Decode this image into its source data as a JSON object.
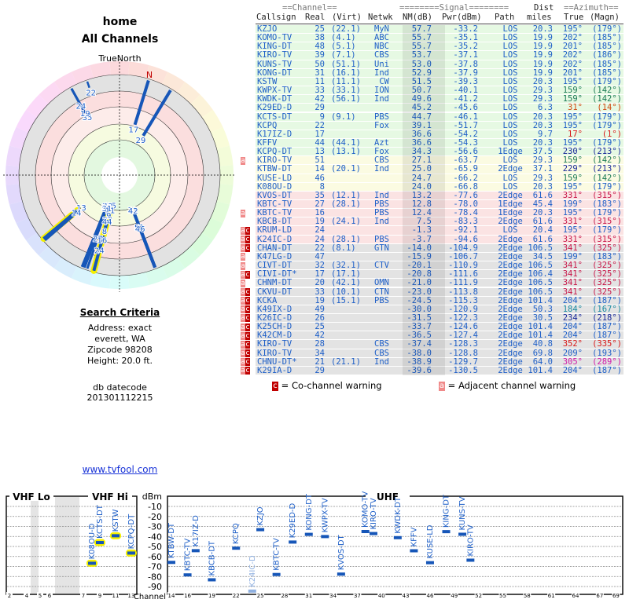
{
  "left": {
    "title": "home",
    "subtitle": "All Channels",
    "compass_label": "TrueNorth",
    "north_marker": "N",
    "search_heading": "Search Criteria",
    "search_lines": [
      "Address: exact",
      "everett, WA",
      "Zipcode 98208",
      "Height: 20.0 ft."
    ],
    "datecode_label": "db datecode",
    "datecode": "201301112215",
    "link": "www.tvfool.com"
  },
  "table": {
    "header_top": {
      "channel": "==Channel==",
      "signal": "========Signal========",
      "dist": "Dist",
      "azimuth": "==Azimuth=="
    },
    "header": {
      "callsign": "Callsign",
      "real": "Real",
      "virt": "(Virt)",
      "netwk": "Netwk",
      "nm": "NM(dB)",
      "pwr": "Pwr(dBm)",
      "path": "Path",
      "miles": "miles",
      "true": "True",
      "magn": "(Magn)"
    },
    "rows": [
      {
        "w": "",
        "call": "KZJO",
        "real": "25",
        "virt": "(22.1)",
        "net": "MyN",
        "nm": "57.7",
        "pwr": "-33.2",
        "path": "LOS",
        "dist": "20.3",
        "az": "195°",
        "mag": "(179°)",
        "color": "#1e5fc8",
        "band": "green"
      },
      {
        "w": "",
        "call": "KOMO-TV",
        "real": "38",
        "virt": "(4.1)",
        "net": "ABC",
        "nm": "55.7",
        "pwr": "-35.1",
        "path": "LOS",
        "dist": "19.9",
        "az": "202°",
        "mag": "(185°)",
        "color": "#1e5fc8",
        "band": "green"
      },
      {
        "w": "",
        "call": "KING-DT",
        "real": "48",
        "virt": "(5.1)",
        "net": "NBC",
        "nm": "55.7",
        "pwr": "-35.2",
        "path": "LOS",
        "dist": "19.9",
        "az": "201°",
        "mag": "(185°)",
        "color": "#1e5fc8",
        "band": "green"
      },
      {
        "w": "",
        "call": "KIRO-TV",
        "real": "39",
        "virt": "(7.1)",
        "net": "CBS",
        "nm": "53.7",
        "pwr": "-37.1",
        "path": "LOS",
        "dist": "19.9",
        "az": "202°",
        "mag": "(186°)",
        "color": "#1e5fc8",
        "band": "green"
      },
      {
        "w": "",
        "call": "KUNS-TV",
        "real": "50",
        "virt": "(51.1)",
        "net": "Uni",
        "nm": "53.0",
        "pwr": "-37.8",
        "path": "LOS",
        "dist": "19.9",
        "az": "202°",
        "mag": "(185°)",
        "color": "#1e5fc8",
        "band": "green"
      },
      {
        "w": "",
        "call": "KONG-DT",
        "real": "31",
        "virt": "(16.1)",
        "net": "Ind",
        "nm": "52.9",
        "pwr": "-37.9",
        "path": "LOS",
        "dist": "19.9",
        "az": "201°",
        "mag": "(185°)",
        "color": "#1e5fc8",
        "band": "green"
      },
      {
        "w": "",
        "call": "KSTW",
        "real": "11",
        "virt": "(11.1)",
        "net": "CW",
        "nm": "51.5",
        "pwr": "-39.3",
        "path": "LOS",
        "dist": "20.3",
        "az": "195°",
        "mag": "(179°)",
        "color": "#1e5fc8",
        "band": "green"
      },
      {
        "w": "",
        "call": "KWPX-TV",
        "real": "33",
        "virt": "(33.1)",
        "net": "ION",
        "nm": "50.7",
        "pwr": "-40.1",
        "path": "LOS",
        "dist": "29.3",
        "az": "159°",
        "mag": "(142°)",
        "color": "#1a7a55",
        "band": "green"
      },
      {
        "w": "",
        "call": "KWDK-DT",
        "real": "42",
        "virt": "(56.1)",
        "net": "Ind",
        "nm": "49.6",
        "pwr": "-41.2",
        "path": "LOS",
        "dist": "29.3",
        "az": "159°",
        "mag": "(142°)",
        "color": "#1a7a55",
        "band": "green"
      },
      {
        "w": "",
        "call": "K29ED-D",
        "real": "29",
        "virt": "",
        "net": "",
        "nm": "45.2",
        "pwr": "-45.6",
        "path": "LOS",
        "dist": "6.3",
        "az": "31°",
        "mag": "(14°)",
        "color": "#d04a10",
        "band": "green"
      },
      {
        "w": "",
        "call": "KCTS-DT",
        "real": "9",
        "virt": "(9.1)",
        "net": "PBS",
        "nm": "44.7",
        "pwr": "-46.1",
        "path": "LOS",
        "dist": "20.3",
        "az": "195°",
        "mag": "(179°)",
        "color": "#1e5fc8",
        "band": "green"
      },
      {
        "w": "",
        "call": "KCPQ",
        "real": "22",
        "virt": "",
        "net": "Fox",
        "nm": "39.1",
        "pwr": "-51.7",
        "path": "LOS",
        "dist": "20.3",
        "az": "195°",
        "mag": "(179°)",
        "color": "#1e5fc8",
        "band": "green"
      },
      {
        "w": "",
        "call": "K17IZ-D",
        "real": "17",
        "virt": "",
        "net": "",
        "nm": "36.6",
        "pwr": "-54.2",
        "path": "LOS",
        "dist": "9.7",
        "az": "17°",
        "mag": "(1°)",
        "color": "#d81818",
        "band": "green"
      },
      {
        "w": "",
        "call": "KFFV",
        "real": "44",
        "virt": "(44.1)",
        "net": "Azt",
        "nm": "36.6",
        "pwr": "-54.3",
        "path": "LOS",
        "dist": "20.3",
        "az": "195°",
        "mag": "(179°)",
        "color": "#1e5fc8",
        "band": "green"
      },
      {
        "w": "",
        "call": "KCPQ-DT",
        "real": "13",
        "virt": "(13.1)",
        "net": "Fox",
        "nm": "34.3",
        "pwr": "-56.6",
        "path": "1Edge",
        "dist": "37.5",
        "az": "230°",
        "mag": "(213°)",
        "color": "#1a2a9a",
        "band": "green"
      },
      {
        "w": "a",
        "call": "KIRO-TV",
        "real": "51",
        "virt": "",
        "net": "CBS",
        "nm": "27.1",
        "pwr": "-63.7",
        "path": "LOS",
        "dist": "29.3",
        "az": "159°",
        "mag": "(142°)",
        "color": "#1a7a55",
        "band": "yellow"
      },
      {
        "w": "",
        "call": "KTBW-DT",
        "real": "14",
        "virt": "(20.1)",
        "net": "Ind",
        "nm": "25.0",
        "pwr": "-65.9",
        "path": "2Edge",
        "dist": "37.1",
        "az": "229°",
        "mag": "(213°)",
        "color": "#1a2a9a",
        "band": "yellow"
      },
      {
        "w": "",
        "call": "KUSE-LD",
        "real": "46",
        "virt": "",
        "net": "",
        "nm": "24.7",
        "pwr": "-66.2",
        "path": "LOS",
        "dist": "29.3",
        "az": "159°",
        "mag": "(142°)",
        "color": "#1a7a55",
        "band": "yellow"
      },
      {
        "w": "",
        "call": "K08OU-D",
        "real": "8",
        "virt": "",
        "net": "",
        "nm": "24.0",
        "pwr": "-66.8",
        "path": "LOS",
        "dist": "20.3",
        "az": "195°",
        "mag": "(179°)",
        "color": "#1e5fc8",
        "band": "yellow"
      },
      {
        "w": "",
        "call": "KVOS-DT",
        "real": "35",
        "virt": "(12.1)",
        "net": "Ind",
        "nm": "13.2",
        "pwr": "-77.6",
        "path": "2Edge",
        "dist": "61.6",
        "az": "331°",
        "mag": "(315°)",
        "color": "#c8184a",
        "band": "pink"
      },
      {
        "w": "",
        "call": "KBTC-TV",
        "real": "27",
        "virt": "(28.1)",
        "net": "PBS",
        "nm": "12.8",
        "pwr": "-78.0",
        "path": "1Edge",
        "dist": "45.4",
        "az": "199°",
        "mag": "(183°)",
        "color": "#1e5fc8",
        "band": "pink"
      },
      {
        "w": "a",
        "call": "KBTC-TV",
        "real": "16",
        "virt": "",
        "net": "PBS",
        "nm": "12.4",
        "pwr": "-78.4",
        "path": "1Edge",
        "dist": "20.3",
        "az": "195°",
        "mag": "(179°)",
        "color": "#1e5fc8",
        "band": "pink"
      },
      {
        "w": "",
        "call": "KBCB-DT",
        "real": "19",
        "virt": "(24.1)",
        "net": "Ind",
        "nm": "7.5",
        "pwr": "-83.3",
        "path": "2Edge",
        "dist": "61.6",
        "az": "331°",
        "mag": "(315°)",
        "color": "#c8184a",
        "band": "pink"
      },
      {
        "w": "ac",
        "call": "KRUM-LD",
        "real": "24",
        "virt": "",
        "net": "",
        "nm": "-1.3",
        "pwr": "-92.1",
        "path": "LOS",
        "dist": "20.4",
        "az": "195°",
        "mag": "(179°)",
        "color": "#1e5fc8",
        "band": "pink"
      },
      {
        "w": "ac",
        "call": "K24IC-D",
        "real": "24",
        "virt": "(28.1)",
        "net": "PBS",
        "nm": "-3.7",
        "pwr": "-94.6",
        "path": "2Edge",
        "dist": "61.6",
        "az": "331°",
        "mag": "(315°)",
        "color": "#c8184a",
        "band": "pink"
      },
      {
        "w": "ac",
        "call": "CHAN-DT",
        "real": "22",
        "virt": "(8.1)",
        "net": "GTN",
        "nm": "-14.0",
        "pwr": "-104.9",
        "path": "2Edge",
        "dist": "106.5",
        "az": "341°",
        "mag": "(325°)",
        "color": "#c8184a",
        "band": "gray"
      },
      {
        "w": "a",
        "call": "K47LG-D",
        "real": "47",
        "virt": "",
        "net": "",
        "nm": "-15.9",
        "pwr": "-106.7",
        "path": "2Edge",
        "dist": "34.5",
        "az": "199°",
        "mag": "(183°)",
        "color": "#1e5fc8",
        "band": "gray"
      },
      {
        "w": "a",
        "call": "CIVT-DT",
        "real": "32",
        "virt": "(32.1)",
        "net": "CTV",
        "nm": "-20.1",
        "pwr": "-110.9",
        "path": "2Edge",
        "dist": "106.5",
        "az": "341°",
        "mag": "(325°)",
        "color": "#c8184a",
        "band": "gray"
      },
      {
        "w": "ac",
        "call": "CIVI-DT*",
        "real": "17",
        "virt": "(17.1)",
        "net": "",
        "nm": "-20.8",
        "pwr": "-111.6",
        "path": "2Edge",
        "dist": "106.4",
        "az": "341°",
        "mag": "(325°)",
        "color": "#c8184a",
        "band": "gray"
      },
      {
        "w": "a",
        "call": "CHNM-DT",
        "real": "20",
        "virt": "(42.1)",
        "net": "OMN",
        "nm": "-21.0",
        "pwr": "-111.9",
        "path": "2Edge",
        "dist": "106.5",
        "az": "341°",
        "mag": "(325°)",
        "color": "#c8184a",
        "band": "gray"
      },
      {
        "w": "ac",
        "call": "CKVU-DT",
        "real": "33",
        "virt": "(10.1)",
        "net": "CTN",
        "nm": "-23.0",
        "pwr": "-113.8",
        "path": "2Edge",
        "dist": "106.5",
        "az": "341°",
        "mag": "(325°)",
        "color": "#c8184a",
        "band": "gray"
      },
      {
        "w": "ac",
        "call": "KCKA",
        "real": "19",
        "virt": "(15.1)",
        "net": "PBS",
        "nm": "-24.5",
        "pwr": "-115.3",
        "path": "2Edge",
        "dist": "101.4",
        "az": "204°",
        "mag": "(187°)",
        "color": "#1e5fc8",
        "band": "gray"
      },
      {
        "w": "ac",
        "call": "K49IX-D",
        "real": "49",
        "virt": "",
        "net": "",
        "nm": "-30.0",
        "pwr": "-120.9",
        "path": "2Edge",
        "dist": "50.3",
        "az": "184°",
        "mag": "(167°)",
        "color": "#1a8aa0",
        "band": "gray"
      },
      {
        "w": "ac",
        "call": "K26IC-D",
        "real": "26",
        "virt": "",
        "net": "",
        "nm": "-31.5",
        "pwr": "-122.3",
        "path": "2Edge",
        "dist": "30.5",
        "az": "234°",
        "mag": "(218°)",
        "color": "#1a2a9a",
        "band": "gray"
      },
      {
        "w": "ac",
        "call": "K25CH-D",
        "real": "25",
        "virt": "",
        "net": "",
        "nm": "-33.7",
        "pwr": "-124.6",
        "path": "2Edge",
        "dist": "101.4",
        "az": "204°",
        "mag": "(187°)",
        "color": "#1e5fc8",
        "band": "gray"
      },
      {
        "w": "ac",
        "call": "K42CM-D",
        "real": "42",
        "virt": "",
        "net": "",
        "nm": "-36.5",
        "pwr": "-127.4",
        "path": "2Edge",
        "dist": "101.4",
        "az": "204°",
        "mag": "(187°)",
        "color": "#1e5fc8",
        "band": "gray"
      },
      {
        "w": "ac",
        "call": "KIRO-TV",
        "real": "28",
        "virt": "",
        "net": "CBS",
        "nm": "-37.4",
        "pwr": "-128.3",
        "path": "2Edge",
        "dist": "40.8",
        "az": "352°",
        "mag": "(335°)",
        "color": "#d81818",
        "band": "gray"
      },
      {
        "w": "ac",
        "call": "KIRO-TV",
        "real": "34",
        "virt": "",
        "net": "CBS",
        "nm": "-38.0",
        "pwr": "-128.8",
        "path": "2Edge",
        "dist": "69.8",
        "az": "209°",
        "mag": "(193°)",
        "color": "#1e5fc8",
        "band": "gray"
      },
      {
        "w": "ac",
        "call": "CHNU-DT*",
        "real": "21",
        "virt": "(21.1)",
        "net": "Ind",
        "nm": "-38.9",
        "pwr": "-129.7",
        "path": "2Edge",
        "dist": "64.0",
        "az": "305°",
        "mag": "(289°)",
        "color": "#d018a8",
        "band": "gray"
      },
      {
        "w": "ac",
        "call": "K29IA-D",
        "real": "29",
        "virt": "",
        "net": "",
        "nm": "-39.6",
        "pwr": "-130.5",
        "path": "2Edge",
        "dist": "101.4",
        "az": "204°",
        "mag": "(187°)",
        "color": "#1e5fc8",
        "band": "gray"
      }
    ],
    "legend": {
      "co_badge": "c",
      "co_text": "= Co-channel warning",
      "adj_badge": "a",
      "adj_text": "= Adjacent channel warning"
    }
  },
  "chart_data": {
    "type": "scatter",
    "title": "",
    "ylabel": "dBm",
    "xlabel": "Channel",
    "ylim": [
      0,
      -95
    ],
    "yticks": [
      "-10",
      "-20",
      "-30",
      "-40",
      "-50",
      "-60",
      "-70",
      "-80",
      "-90"
    ],
    "sections": [
      "VHF Lo",
      "VHF Hi",
      "UHF"
    ],
    "vhf_ticks": [
      "2",
      "4",
      "5",
      "6",
      "7",
      "9",
      "11",
      "13"
    ],
    "uhf_ticks": [
      "14",
      "16",
      "19",
      "22",
      "25",
      "28",
      "31",
      "34",
      "37",
      "40",
      "43",
      "46",
      "49",
      "52",
      "55",
      "58",
      "61",
      "64",
      "67",
      "69"
    ],
    "points": [
      {
        "label": "K08OU-D",
        "channel": 8,
        "dbm": -66.8,
        "highlight": true
      },
      {
        "label": "KCTS-DT",
        "channel": 9,
        "dbm": -46.1,
        "highlight": true
      },
      {
        "label": "KSTW",
        "channel": 11,
        "dbm": -39.3,
        "highlight": true
      },
      {
        "label": "KCPQ-DT",
        "channel": 13,
        "dbm": -56.6,
        "highlight": true
      },
      {
        "label": "KTBW-DT",
        "channel": 14,
        "dbm": -65.9
      },
      {
        "label": "KBTC-TV",
        "channel": 16,
        "dbm": -78.4
      },
      {
        "label": "K17IZ-D",
        "channel": 17,
        "dbm": -54.2
      },
      {
        "label": "KBCB-DT",
        "channel": 19,
        "dbm": -83.3
      },
      {
        "label": "KCPQ",
        "channel": 22,
        "dbm": -51.7
      },
      {
        "label": "K24IC-D",
        "channel": 24,
        "dbm": -94.6,
        "faded": true
      },
      {
        "label": "KZJO",
        "channel": 25,
        "dbm": -33.2
      },
      {
        "label": "KBTC-TV",
        "channel": 27,
        "dbm": -78.0
      },
      {
        "label": "K29ED-D",
        "channel": 29,
        "dbm": -45.6
      },
      {
        "label": "KONG-DT",
        "channel": 31,
        "dbm": -37.9
      },
      {
        "label": "KWPX-TV",
        "channel": 33,
        "dbm": -40.1
      },
      {
        "label": "KVOS-DT",
        "channel": 35,
        "dbm": -77.6
      },
      {
        "label": "KOMO-TV",
        "channel": 38,
        "dbm": -35.1
      },
      {
        "label": "KIRO-TV",
        "channel": 39,
        "dbm": -37.1
      },
      {
        "label": "KWDK-DT",
        "channel": 42,
        "dbm": -41.2
      },
      {
        "label": "KFFV",
        "channel": 44,
        "dbm": -54.3
      },
      {
        "label": "KUSE-LD",
        "channel": 46,
        "dbm": -66.2
      },
      {
        "label": "KING-DT",
        "channel": 48,
        "dbm": -35.2
      },
      {
        "label": "KUNS-TV",
        "channel": 50,
        "dbm": -37.8
      },
      {
        "label": "KIRO-TV",
        "channel": 51,
        "dbm": -63.7
      }
    ]
  },
  "colors": {
    "link_blue": "#1e5fc8",
    "co_warn": "#c00000",
    "adj_warn": "#f08a8a",
    "highlight": "#f5f000"
  }
}
